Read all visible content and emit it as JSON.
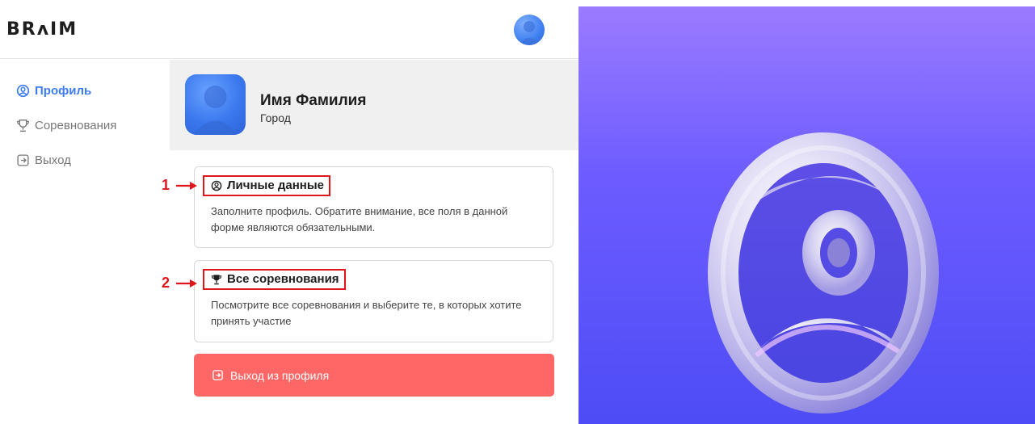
{
  "brand": {
    "logo_text": "BRʌIM"
  },
  "sidebar": {
    "items": [
      {
        "label": "Профиль",
        "icon": "user-circle-icon",
        "active": true
      },
      {
        "label": "Соревнования",
        "icon": "trophy-icon",
        "active": false
      },
      {
        "label": "Выход",
        "icon": "logout-icon",
        "active": false
      }
    ]
  },
  "profile": {
    "name": "Имя Фамилия",
    "city": "Город"
  },
  "cards": [
    {
      "marker": "1",
      "icon": "user-circle-icon",
      "title": "Личные данные",
      "description": "Заполните профиль. Обратите внимание, все поля в данной форме являются обязательными."
    },
    {
      "marker": "2",
      "icon": "trophy-icon",
      "title": "Все соревнования",
      "description": "Посмотрите все соревнования и выберите те, в которых хотите принять участие"
    }
  ],
  "logout_button": {
    "label": "Выход из профиля",
    "icon": "logout-icon"
  },
  "colors": {
    "accent": "#3d7cf0",
    "logout": "#ff6666",
    "annotation": "#e0151b",
    "hero_top": "#9b7bff",
    "hero_bottom": "#4d4cf6"
  }
}
